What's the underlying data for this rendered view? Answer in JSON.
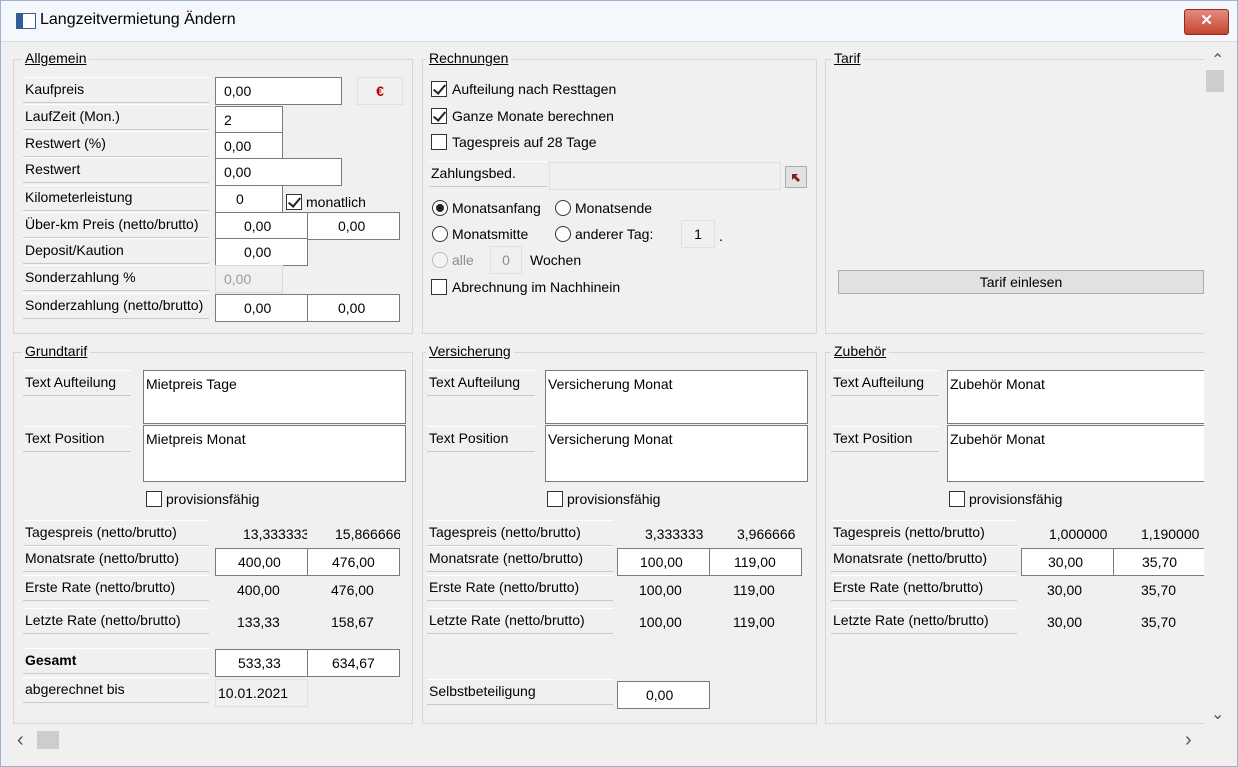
{
  "window": {
    "title": "Langzeitvermietung Ändern",
    "close": "✕"
  },
  "allgemein": {
    "title": "Allgemein",
    "kaufpreis_label": "Kaufpreis",
    "kaufpreis": "0,00",
    "currency": "€",
    "laufzeit_label": "LaufZeit (Mon.)",
    "laufzeit": "2",
    "restwert_pct_label": "Restwert (%)",
    "restwert_pct": "0,00",
    "restwert_label": "Restwert",
    "restwert": "0,00",
    "km_label": "Kilometerleistung",
    "km": "0",
    "monatlich": "monatlich",
    "ueberkm_label": "Über-km Preis (netto/brutto)",
    "ueberkm_netto": "0,00",
    "ueberkm_brutto": "0,00",
    "deposit_label": "Deposit/Kaution",
    "deposit": "0,00",
    "sonder_pct_label": "Sonderzahlung %",
    "sonder_pct": "0,00",
    "sonder_label": "Sonderzahlung (netto/brutto)",
    "sonder_netto": "0,00",
    "sonder_brutto": "0,00"
  },
  "rechnungen": {
    "title": "Rechnungen",
    "aufteilung": "Aufteilung nach Resttagen",
    "ganze_monate": "Ganze Monate berechnen",
    "tagespreis28": "Tagespreis auf 28 Tage",
    "zahlungsbed_label": "Zahlungsbed.",
    "zahlungsbed": "",
    "monatsanfang": "Monatsanfang",
    "monatsende": "Monatsende",
    "monatsmitte": "Monatsmitte",
    "anderer_tag": "anderer Tag:",
    "anderer_tag_value": "1",
    "dot": ".",
    "alle": "alle",
    "wochen_value": "0",
    "wochen": "Wochen",
    "nachhinein": "Abrechnung im Nachhinein"
  },
  "tarif": {
    "title": "Tarif",
    "einlesen": "Tarif einlesen"
  },
  "grundtarif": {
    "title": "Grundtarif",
    "text_aufteilung_label": "Text Aufteilung",
    "text_aufteilung": "Mietpreis Tage",
    "text_position_label": "Text Position",
    "text_position": "Mietpreis Monat",
    "provision": "provisionsfähig",
    "tagespreis_label": "Tagespreis (netto/brutto)",
    "tagespreis_netto": "13,333333",
    "tagespreis_brutto": "15,866666",
    "monatsrate_label": "Monatsrate (netto/brutto)",
    "monatsrate_netto": "400,00",
    "monatsrate_brutto": "476,00",
    "erste_label": "Erste Rate (netto/brutto)",
    "erste_netto": "400,00",
    "erste_brutto": "476,00",
    "letzte_label": "Letzte Rate (netto/brutto)",
    "letzte_netto": "133,33",
    "letzte_brutto": "158,67",
    "gesamt_label": "Gesamt",
    "gesamt_netto": "533,33",
    "gesamt_brutto": "634,67",
    "abgerechnet_label": "abgerechnet bis",
    "abgerechnet": "10.01.2021"
  },
  "versicherung": {
    "title": "Versicherung",
    "text_aufteilung_label": "Text Aufteilung",
    "text_aufteilung": "Versicherung Monat",
    "text_position_label": "Text Position",
    "text_position": "Versicherung Monat",
    "provision": "provisionsfähig",
    "tagespreis_label": "Tagespreis (netto/brutto)",
    "tagespreis_netto": "3,333333",
    "tagespreis_brutto": "3,966666",
    "monatsrate_label": "Monatsrate (netto/brutto)",
    "monatsrate_netto": "100,00",
    "monatsrate_brutto": "119,00",
    "erste_label": "Erste Rate (netto/brutto)",
    "erste_netto": "100,00",
    "erste_brutto": "119,00",
    "letzte_label": "Letzte Rate (netto/brutto)",
    "letzte_netto": "100,00",
    "letzte_brutto": "119,00",
    "selbst_label": "Selbstbeteiligung",
    "selbst": "0,00"
  },
  "zubehoer": {
    "title": "Zubehör",
    "text_aufteilung_label": "Text Aufteilung",
    "text_aufteilung": "Zubehör Monat",
    "text_position_label": "Text Position",
    "text_position": "Zubehör Monat",
    "provision": "provisionsfähig",
    "tagespreis_label": "Tagespreis (netto/brutto)",
    "tagespreis_netto": "1,000000",
    "tagespreis_brutto": "1,190000",
    "monatsrate_label": "Monatsrate (netto/brutto)",
    "monatsrate_netto": "30,00",
    "monatsrate_brutto": "35,70",
    "erste_label": "Erste Rate (netto/brutto)",
    "erste_netto": "30,00",
    "erste_brutto": "35,70",
    "letzte_label": "Letzte Rate (netto/brutto)",
    "letzte_netto": "30,00",
    "letzte_brutto": "35,70"
  },
  "scroll": {
    "up": "⌃",
    "down": "⌄",
    "left": "‹",
    "right": "›"
  }
}
